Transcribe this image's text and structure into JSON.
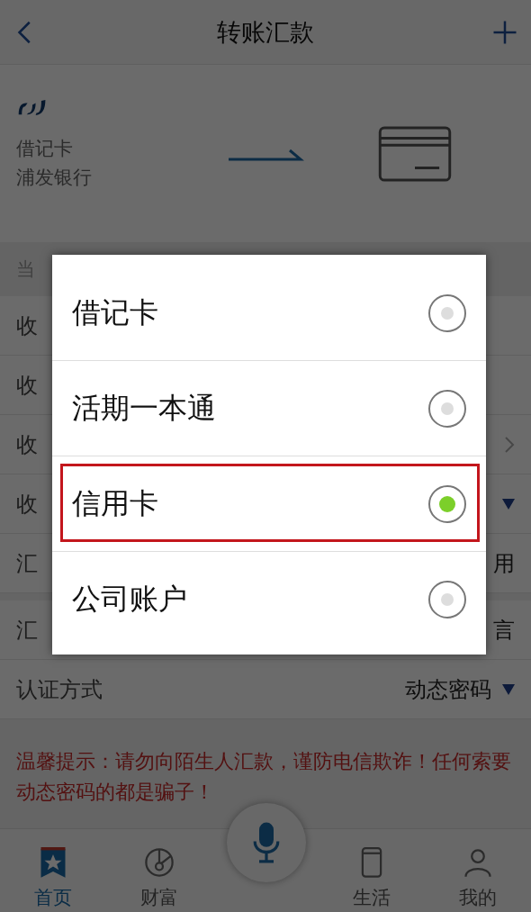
{
  "header": {
    "title": "转账汇款"
  },
  "transfer": {
    "card_type": "借记卡",
    "bank": "浦发银行"
  },
  "form": {
    "section_label": "当",
    "groups": [
      {
        "rows": [
          {
            "label": "收"
          },
          {
            "label": "收"
          },
          {
            "label": "收",
            "chevron": true
          },
          {
            "label": "收",
            "dropdown": true
          },
          {
            "label": "汇",
            "value": "用"
          }
        ]
      },
      {
        "rows": [
          {
            "label": "汇",
            "value": "言"
          },
          {
            "label": "认证方式",
            "value": "动态密码",
            "dropdown": true
          }
        ]
      }
    ]
  },
  "notice": "温馨提示：请勿向陌生人汇款，谨防电信欺诈！任何索要动态密码的都是骗子！",
  "nav": [
    {
      "label": "首页",
      "kind": "star",
      "selected": true
    },
    {
      "label": "财富",
      "kind": "dial",
      "selected": false
    },
    {
      "label": "生活",
      "kind": "phone",
      "selected": false
    },
    {
      "label": "我的",
      "kind": "person",
      "selected": false
    }
  ],
  "dialog": {
    "options": [
      {
        "label": "借记卡",
        "selected": false,
        "highlighted": false
      },
      {
        "label": "活期一本通",
        "selected": false,
        "highlighted": false
      },
      {
        "label": "信用卡",
        "selected": true,
        "highlighted": true
      },
      {
        "label": "公司账户",
        "selected": false,
        "highlighted": false
      }
    ]
  }
}
